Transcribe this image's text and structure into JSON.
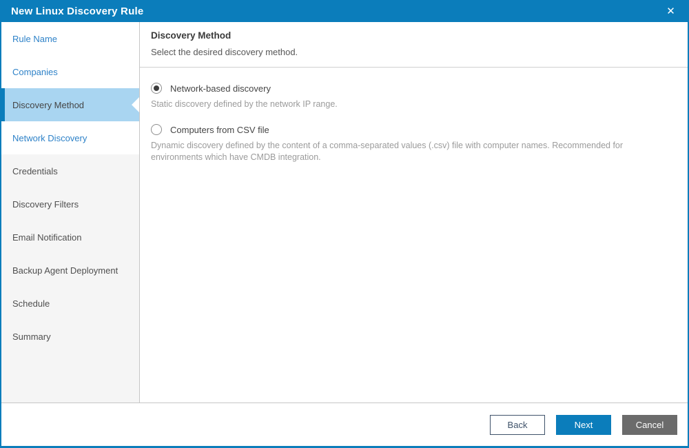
{
  "colors": {
    "accent": "#0b7dbb",
    "active-bg": "#a9d5f1",
    "link-blue": "#2e82c8",
    "disabled-bg": "#f5f5f5",
    "back-navy": "#3e5169",
    "cancel-gray": "#6b6b6b"
  },
  "window": {
    "title": "New Linux Discovery Rule",
    "close_icon": "✕"
  },
  "sidebar": {
    "items": [
      {
        "label": "Rule Name",
        "state": "enabled"
      },
      {
        "label": "Companies",
        "state": "enabled"
      },
      {
        "label": "Discovery Method",
        "state": "active"
      },
      {
        "label": "Network Discovery",
        "state": "enabled"
      },
      {
        "label": "Credentials",
        "state": "disabled"
      },
      {
        "label": "Discovery Filters",
        "state": "disabled"
      },
      {
        "label": "Email Notification",
        "state": "disabled"
      },
      {
        "label": "Backup Agent Deployment",
        "state": "disabled"
      },
      {
        "label": "Schedule",
        "state": "disabled"
      },
      {
        "label": "Summary",
        "state": "disabled"
      }
    ]
  },
  "main": {
    "heading": "Discovery Method",
    "subheading": "Select the desired discovery method.",
    "options": [
      {
        "label": "Network-based discovery",
        "description": "Static discovery defined by the network IP range.",
        "selected": true
      },
      {
        "label": "Computers from CSV file",
        "description": "Dynamic discovery defined by the content of a comma-separated values (.csv) file with computer names. Recommended for environments which have CMDB integration.",
        "selected": false
      }
    ]
  },
  "footer": {
    "back_label": "Back",
    "next_label": "Next",
    "cancel_label": "Cancel"
  }
}
